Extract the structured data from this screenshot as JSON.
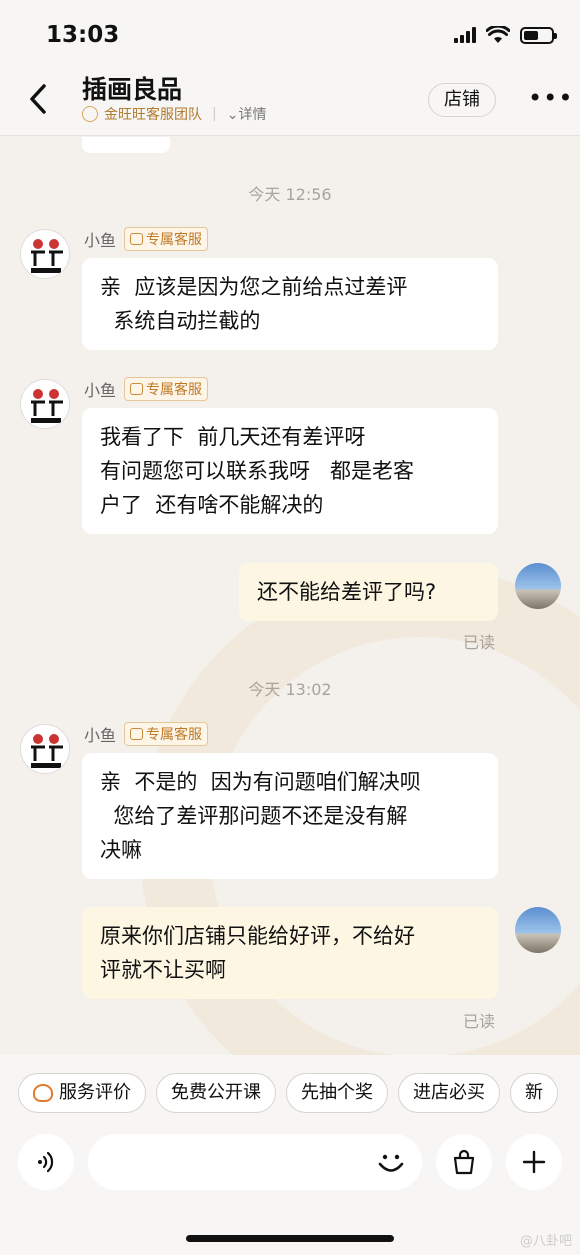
{
  "status_bar": {
    "time": "13:03"
  },
  "header": {
    "title": "插画良品",
    "team": "金旺旺客服团队",
    "detail": "详情",
    "store_button": "店铺",
    "more": "•••"
  },
  "chat": {
    "timestamps": [
      "今天 12:56",
      "今天 13:02"
    ],
    "agent_name": "小鱼",
    "agent_tag": "专属客服",
    "messages": [
      {
        "from": "agent",
        "text": "亲  应该是因为您之前给点过差评\n  系统自动拦截的"
      },
      {
        "from": "agent",
        "text": "我看了下  前几天还有差评呀\n有问题您可以联系我呀   都是老客\n户了  还有啥不能解决的"
      },
      {
        "from": "user",
        "text": "还不能给差评了吗?",
        "status": "已读"
      },
      {
        "from": "agent",
        "text": "亲  不是的  因为有问题咱们解决呗\n  您给了差评那问题不还是没有解\n决嘛"
      },
      {
        "from": "user",
        "text": "原来你们店铺只能给好评，不给好\n评就不让买啊",
        "status": "已读"
      }
    ]
  },
  "quick_actions": [
    "服务评价",
    "免费公开课",
    "先抽个奖",
    "进店必买",
    "新"
  ],
  "colors": {
    "accent": "#c07a26",
    "user_bubble": "#fdf6e3",
    "background": "#f4f1ec"
  },
  "watermark": "@八卦吧"
}
